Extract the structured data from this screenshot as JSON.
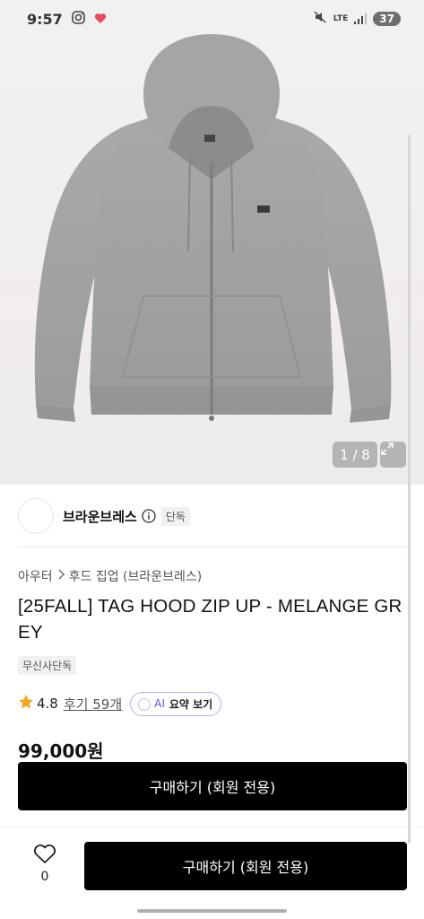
{
  "status_bar": {
    "time": "9:57",
    "network": "LTE",
    "battery": "37"
  },
  "product_image": {
    "counter": "1 / 8"
  },
  "brand": {
    "name": "브라운브레스",
    "tag": "단독"
  },
  "breadcrumb": {
    "category": "아우터",
    "subcategory": "후드 집업 (브라운브레스)"
  },
  "product": {
    "title": "[25FALL] TAG HOOD ZIP UP - MELANGE GREY",
    "exclusive_tag": "무신사단독",
    "rating": "4.8",
    "reviews": "후기 59개",
    "price": "99,000원"
  },
  "ai_summary": {
    "label": "AI",
    "text": "요약 보기"
  },
  "actions": {
    "buy_label": "구매하기 (회원 전용)",
    "like_count": "0"
  },
  "colors": {
    "accent_star": "#f5a623",
    "button_bg": "#000000",
    "ai_purple": "#6a4fd8"
  }
}
